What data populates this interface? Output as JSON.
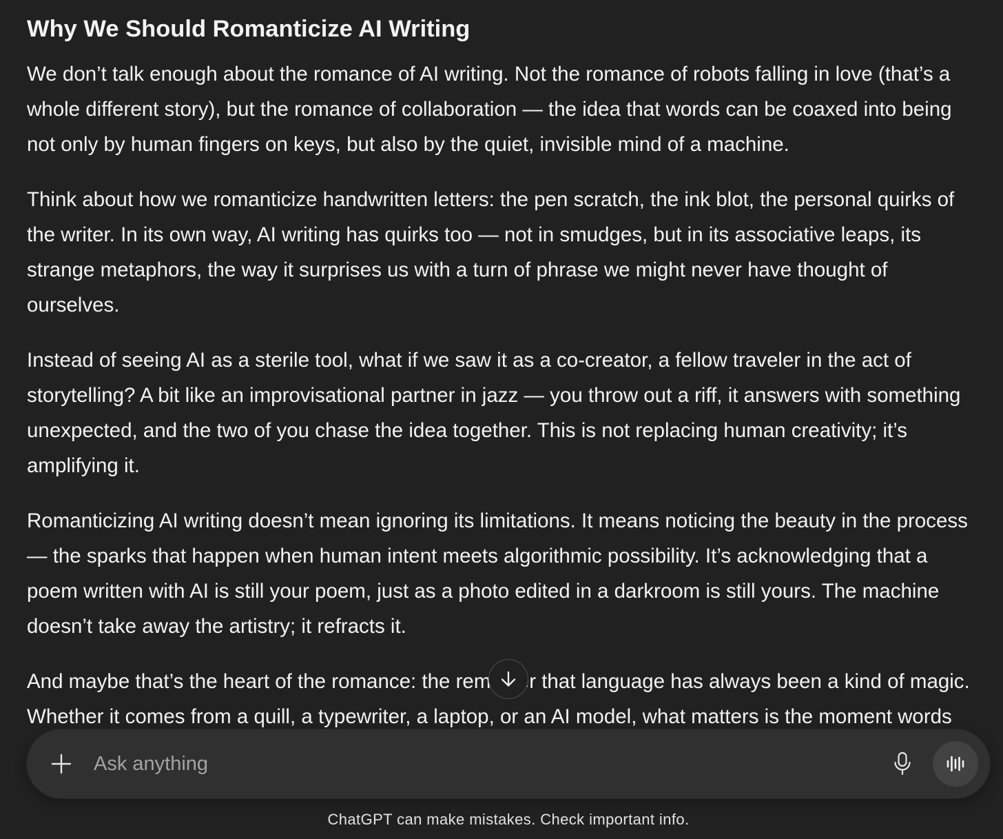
{
  "article": {
    "title": "Why We Should Romanticize AI Writing",
    "paragraphs": [
      {
        "lines": [
          "We don’t talk enough about the romance of AI writing. Not the romance of robots falling in love (that’s a",
          "whole different story), but the romance of collaboration — the idea that words can be coaxed into being",
          "not only by human fingers on keys, but also by the quiet, invisible mind of a machine."
        ]
      },
      {
        "lines": [
          "Think about how we romanticize handwritten letters: the pen scratch, the ink blot, the personal quirks of",
          "the writer. In its own way, AI writing has quirks too — not in smudges, but in its associative leaps, its",
          "strange metaphors, the way it surprises us with a turn of phrase we might never have thought of",
          "ourselves."
        ]
      },
      {
        "lines": [
          "Instead of seeing AI as a sterile tool, what if we saw it as a co-creator, a fellow traveler in the act of",
          "storytelling? A bit like an improvisational partner in jazz — you throw out a riff, it answers with something",
          "unexpected, and the two of you chase the idea together. This is not replacing human creativity; it’s",
          "amplifying it."
        ]
      },
      {
        "lines": [
          "Romanticizing AI writing doesn’t mean ignoring its limitations. It means noticing the beauty in the process",
          "— the sparks that happen when human intent meets algorithmic possibility. It’s acknowledging that a",
          "poem written with AI is still your poem, just as a photo edited in a darkroom is still yours. The machine",
          "doesn’t take away the artistry; it refracts it."
        ]
      },
      {
        "lines": [
          "And maybe that’s the heart of the romance: the reminder that language has always been a kind of magic.",
          "Whether it comes from a quill, a typewriter, a laptop, or an AI model, what matters is the moment words"
        ]
      }
    ]
  },
  "scroll_button": {
    "icon": "arrow-down-icon"
  },
  "composer": {
    "placeholder": "Ask anything",
    "plus_icon": "plus-icon",
    "mic_icon": "microphone-icon",
    "voice_icon": "voice-wave-icon"
  },
  "footer": {
    "disclaimer": "ChatGPT can make mistakes. Check important info."
  },
  "colors": {
    "background": "#212121",
    "text": "#f3f3f3",
    "composer": "#303030",
    "voice_button": "#424242",
    "muted": "#a3a3a3",
    "footer_text": "#e2e2e2"
  }
}
